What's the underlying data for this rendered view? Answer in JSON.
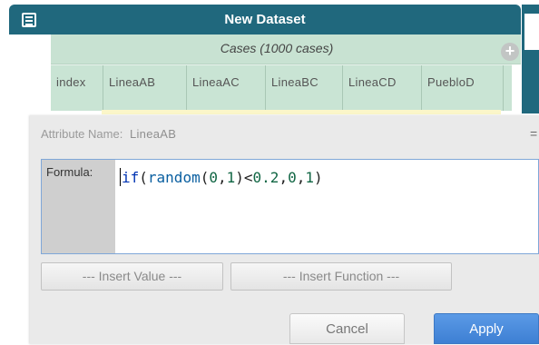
{
  "window": {
    "title": "New Dataset",
    "icon": "table-icon",
    "accent_color": "#20687d"
  },
  "collection": {
    "title": "Cases (1000 cases)",
    "add_attribute_icon": "plus-circle-icon",
    "header_color": "#c9e4d4"
  },
  "table": {
    "columns": [
      "index",
      "LineaAB",
      "LineaAC",
      "LineaBC",
      "LineaCD",
      "PuebloD"
    ]
  },
  "dialog": {
    "attribute_label": "Attribute Name:",
    "attribute_value": "LineaAB",
    "formula_label": "Formula:",
    "formula": {
      "text": "if(random(0,1)<0.2,0,1)",
      "tokens": [
        {
          "t": "if",
          "k": "kw"
        },
        {
          "t": "(",
          "k": "plain"
        },
        {
          "t": "random",
          "k": "fn"
        },
        {
          "t": "(",
          "k": "plain"
        },
        {
          "t": "0",
          "k": "num"
        },
        {
          "t": ",",
          "k": "plain"
        },
        {
          "t": "1",
          "k": "num"
        },
        {
          "t": ")<",
          "k": "plain"
        },
        {
          "t": "0.2",
          "k": "num"
        },
        {
          "t": ",",
          "k": "plain"
        },
        {
          "t": "0",
          "k": "num"
        },
        {
          "t": ",",
          "k": "plain"
        },
        {
          "t": "1",
          "k": "num"
        },
        {
          "t": ")",
          "k": "plain"
        }
      ]
    },
    "insert_value_label": "--- Insert Value ---",
    "insert_function_label": "--- Insert Function ---",
    "cancel_label": "Cancel",
    "apply_label": "Apply",
    "apply_color": "#3d7fd3"
  }
}
